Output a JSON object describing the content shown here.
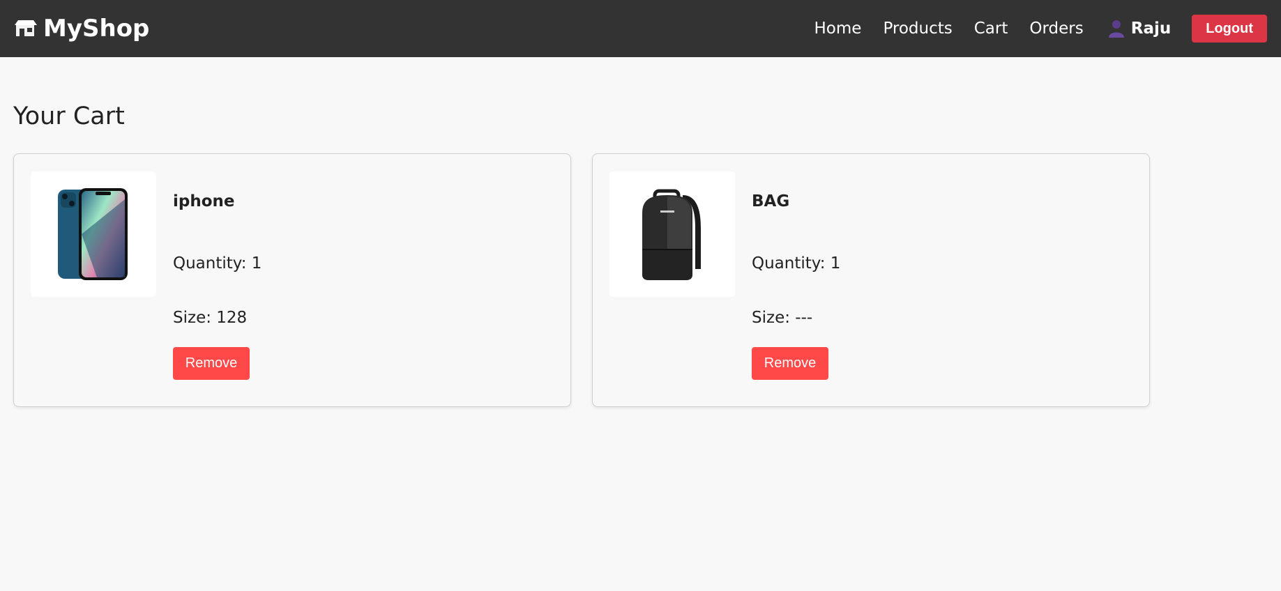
{
  "header": {
    "brand": "MyShop",
    "brand_icon": "shop-icon",
    "nav": [
      "Home",
      "Products",
      "Cart",
      "Orders"
    ],
    "user_icon": "user-icon",
    "user_name": "Raju",
    "logout_label": "Logout"
  },
  "page": {
    "title": "Your Cart"
  },
  "cart": {
    "items": [
      {
        "name": "iphone",
        "qty_text": "Quantity: 1",
        "size_text": "Size: 128",
        "remove_label": "Remove",
        "image": "iphone-image"
      },
      {
        "name": "BAG",
        "qty_text": "Quantity: 1",
        "size_text": "Size: ---",
        "remove_label": "Remove",
        "image": "backpack-image"
      }
    ]
  },
  "colors": {
    "navbar": "#333333",
    "logout": "#dc3545",
    "remove": "#ff4848",
    "background": "#f8f8f8"
  }
}
